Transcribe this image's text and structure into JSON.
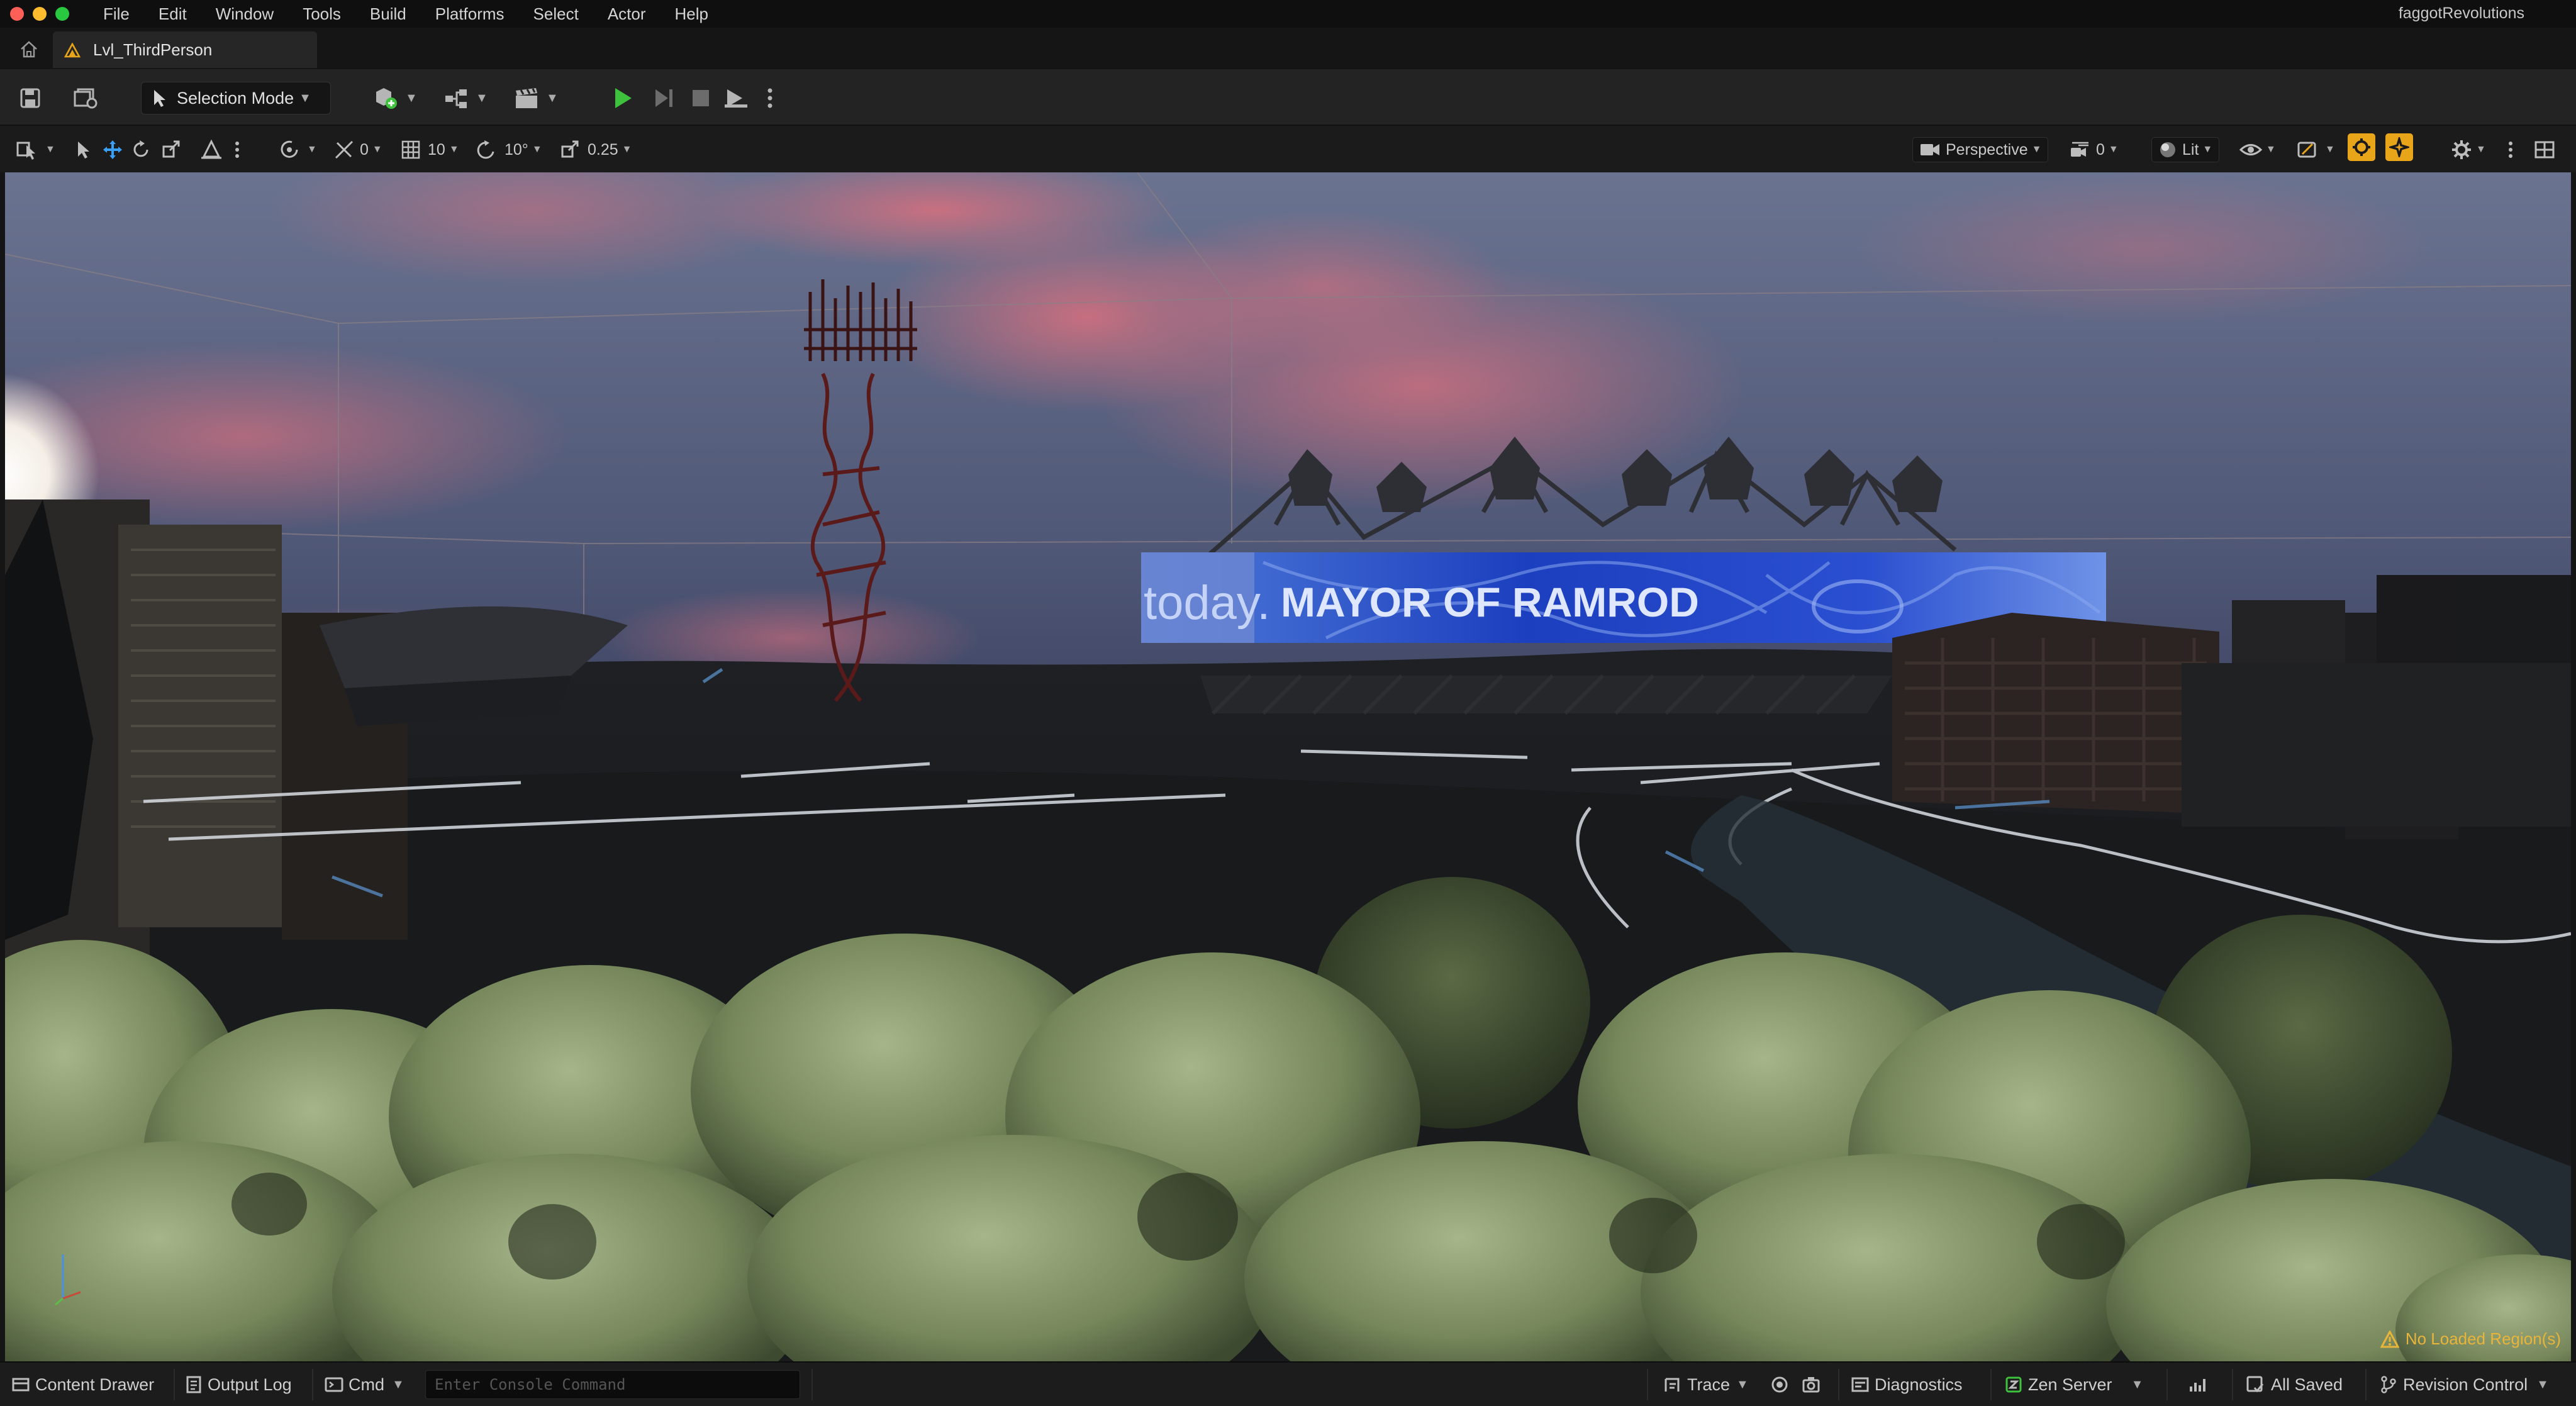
{
  "menubar": {
    "items": [
      "File",
      "Edit",
      "Window",
      "Tools",
      "Build",
      "Platforms",
      "Select",
      "Actor",
      "Help"
    ],
    "project_name": "faggotRevolutions"
  },
  "tabs": {
    "level_tab_label": "Lvl_ThirdPerson"
  },
  "toolbar": {
    "selection_mode_label": "Selection Mode",
    "play_color": "#3ec23e"
  },
  "viewport_toolbar": {
    "rotation_count": "0",
    "grid_snap": "10",
    "rotation_snap": "10°",
    "scale_snap": "0.25",
    "view_mode": "Perspective",
    "camera_speed": "0",
    "lighting_mode": "Lit",
    "accent_color": "#e9a51a"
  },
  "viewport": {
    "billboard_text_left": "today.",
    "billboard_text_main": "MAYOR OF RAMROD",
    "region_warning": "No Loaded Region(s)",
    "warning_color": "#e8b43a"
  },
  "statusbar": {
    "content_drawer": "Content Drawer",
    "output_log": "Output Log",
    "cmd_label": "Cmd",
    "console_placeholder": "Enter Console Command",
    "trace": "Trace",
    "diagnostics": "Diagnostics",
    "zen_server": "Zen Server",
    "all_saved": "All Saved",
    "revision_control": "Revision Control"
  }
}
